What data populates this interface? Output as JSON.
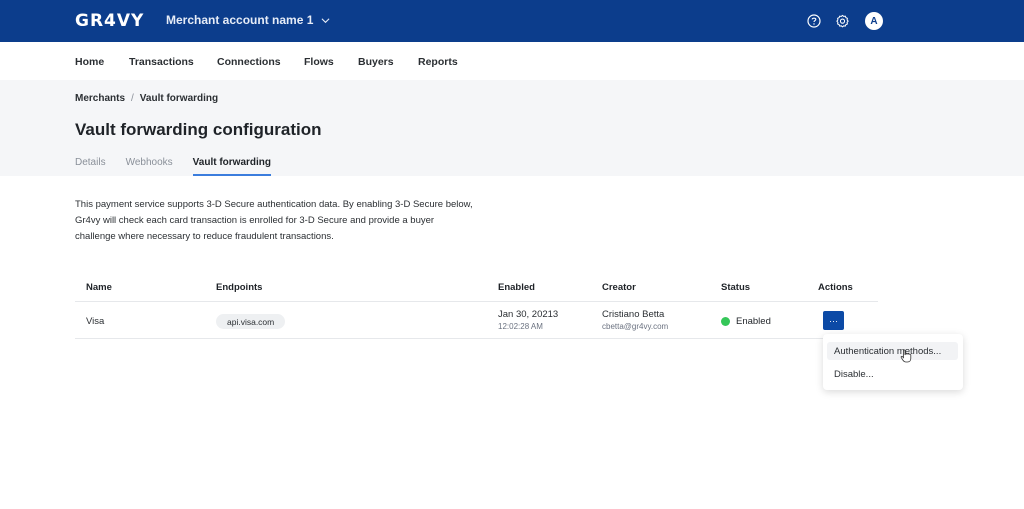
{
  "topbar": {
    "logo": "GR4VY",
    "merchant_name": "Merchant account name 1",
    "icons": [
      "help-icon",
      "settings-icon"
    ],
    "avatar_initial": "A"
  },
  "nav": {
    "items": [
      "Home",
      "Transactions",
      "Connections",
      "Flows",
      "Buyers",
      "Reports"
    ]
  },
  "breadcrumb": {
    "items": [
      "Merchants",
      "Vault forwarding"
    ],
    "separator": "/"
  },
  "page": {
    "title": "Vault forwarding configuration",
    "tabs": [
      {
        "label": "Details",
        "active": false
      },
      {
        "label": "Webhooks",
        "active": false
      },
      {
        "label": "Vault forwarding",
        "active": true
      }
    ],
    "description": "This payment service supports 3-D Secure authentication data. By enabling 3-D Secure below, Gr4vy will check each card transaction is enrolled for 3-D Secure and provide a buyer challenge where necessary to reduce fraudulent transactions."
  },
  "table": {
    "columns": [
      "Name",
      "Endpoints",
      "Enabled",
      "Creator",
      "Status",
      "Actions"
    ],
    "rows": [
      {
        "name": "Visa",
        "endpoint": "api.visa.com",
        "enabled_date": "Jan 30, 20213",
        "enabled_time": "12:02:28 AM",
        "creator_name": "Cristiano Betta",
        "creator_email": "cbetta@gr4vy.com",
        "status": "Enabled",
        "status_color": "#35c759",
        "actions_label": "···"
      }
    ]
  },
  "actions_menu": {
    "items": [
      "Authentication methods...",
      "Disable..."
    ],
    "hovered": "Authentication methods..."
  },
  "colors": {
    "brand": "#0c3d8c",
    "accent": "#3b7ddd",
    "action_button": "#0c4aa6"
  }
}
